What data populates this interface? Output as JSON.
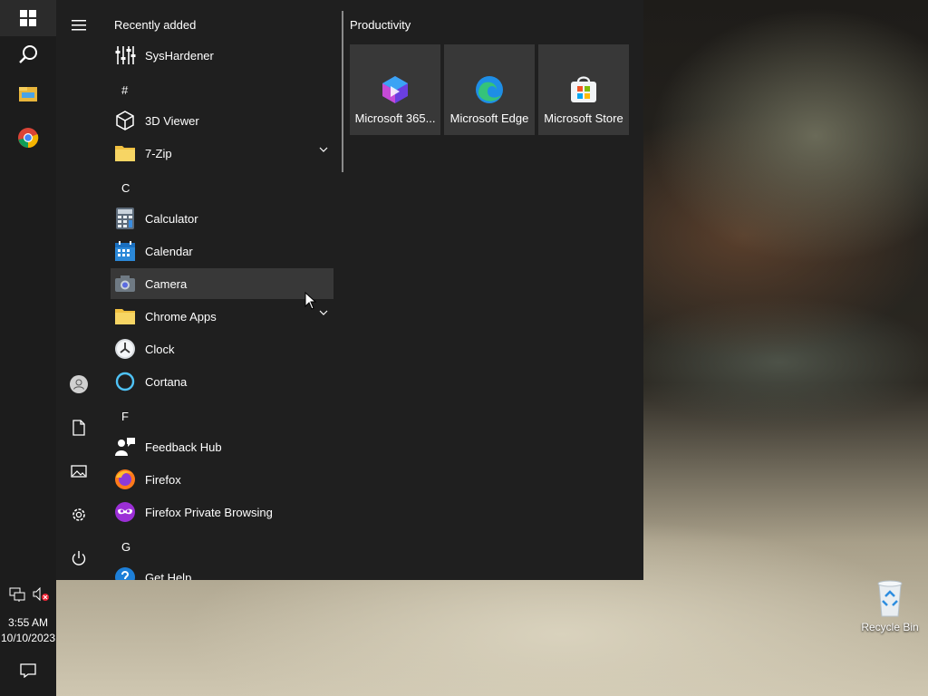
{
  "taskbar": {
    "icons": [
      "windows-logo-icon",
      "search-icon",
      "file-explorer-icon",
      "chrome-icon"
    ],
    "tray": [
      "network-icon",
      "volume-muted-icon"
    ],
    "time": "3:55 AM",
    "date": "10/10/2023",
    "notification_icon": "action-center-icon"
  },
  "start_menu": {
    "rail": [
      "hamburger-menu-icon",
      "user-icon",
      "documents-icon",
      "pictures-icon",
      "settings-icon",
      "power-icon"
    ],
    "recently_added_title": "Recently added",
    "apps": [
      {
        "label": "SysHardener",
        "icon": "sliders-icon"
      },
      {
        "letter": "#"
      },
      {
        "label": "3D Viewer",
        "icon": "cube-icon"
      },
      {
        "label": "7-Zip",
        "icon": "folder-icon",
        "expandable": true
      },
      {
        "letter": "C"
      },
      {
        "label": "Calculator",
        "icon": "calculator-icon"
      },
      {
        "label": "Calendar",
        "icon": "calendar-icon"
      },
      {
        "label": "Camera",
        "icon": "camera-icon",
        "hovered": true
      },
      {
        "label": "Chrome Apps",
        "icon": "folder-icon",
        "expandable": true
      },
      {
        "label": "Clock",
        "icon": "clock-icon"
      },
      {
        "label": "Cortana",
        "icon": "cortana-icon"
      },
      {
        "letter": "F"
      },
      {
        "label": "Feedback Hub",
        "icon": "feedback-icon"
      },
      {
        "label": "Firefox",
        "icon": "firefox-icon"
      },
      {
        "label": "Firefox Private Browsing",
        "icon": "firefox-private-icon"
      },
      {
        "letter": "G"
      },
      {
        "label": "Get Help",
        "icon": "help-icon"
      }
    ],
    "tiles_group_title": "Productivity",
    "tiles": [
      {
        "label": "Microsoft 365...",
        "icon": "microsoft-365-icon"
      },
      {
        "label": "Microsoft Edge",
        "icon": "edge-icon"
      },
      {
        "label": "Microsoft Store",
        "icon": "store-icon"
      }
    ]
  },
  "desktop": {
    "recycle_bin_label": "Recycle Bin"
  },
  "colors": {
    "menu_bg": "#1f1f1f",
    "taskbar_bg": "#1c1c1c",
    "tile_bg": "#383838",
    "hover_bg": "#383838"
  }
}
